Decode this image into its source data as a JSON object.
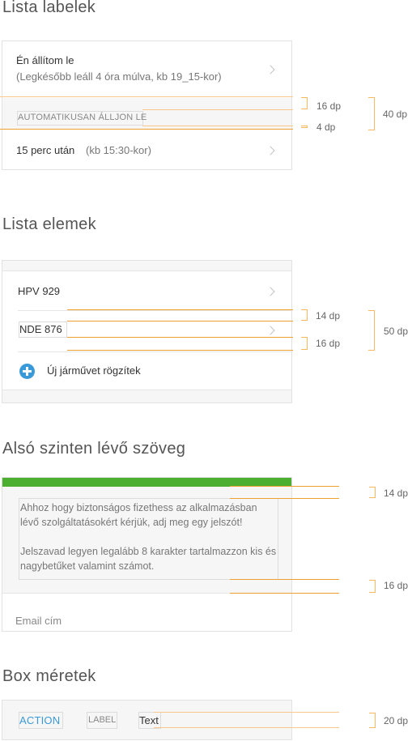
{
  "sections": {
    "list_labels": {
      "title": "Lista labelek",
      "item1_title": "Én állítom le",
      "item1_subtitle": "(Legkésőbb leáll 4 óra múlva, kb 19_15-kor)",
      "section_label": "AUTOMATIKUSAN ÁLLJON LE",
      "item2_title": "15 perc után",
      "item2_subtitle": "(kb 15:30-kor)",
      "annotations": {
        "top": "16 dp",
        "bottom": "4 dp",
        "total": "40 dp"
      }
    },
    "list_items": {
      "title": "Lista elemek",
      "items": [
        {
          "label": "HPV 929"
        },
        {
          "label": "NDE 876"
        }
      ],
      "add_label": "Új járművet rögzítek",
      "annotations": {
        "top": "14 dp",
        "bottom": "16 dp",
        "total": "50 dp"
      }
    },
    "bottom_text": {
      "title": "Alsó szinten lévő szöveg",
      "paragraph1": "Ahhoz hogy biztonságos fizethess az alkalmazásban lévő szolgáltatásokért kérjük, adj meg egy jelszót!",
      "paragraph2": "Jelszavad legyen legalább 8 karakter tartalmazzon kis és nagybetűket valamint számot.",
      "email_placeholder": "Email cím",
      "annotations": {
        "top": "14 dp",
        "bottom": "16 dp"
      }
    },
    "box_sizes": {
      "title": "Box méretek",
      "action": "ACTION",
      "label": "LABEL",
      "text": "Text",
      "annotations": {
        "height": "20 dp"
      }
    }
  },
  "colors": {
    "accent_orange": "#f0a030",
    "action_blue": "#3a9ad9",
    "header_green": "#4caf32"
  }
}
